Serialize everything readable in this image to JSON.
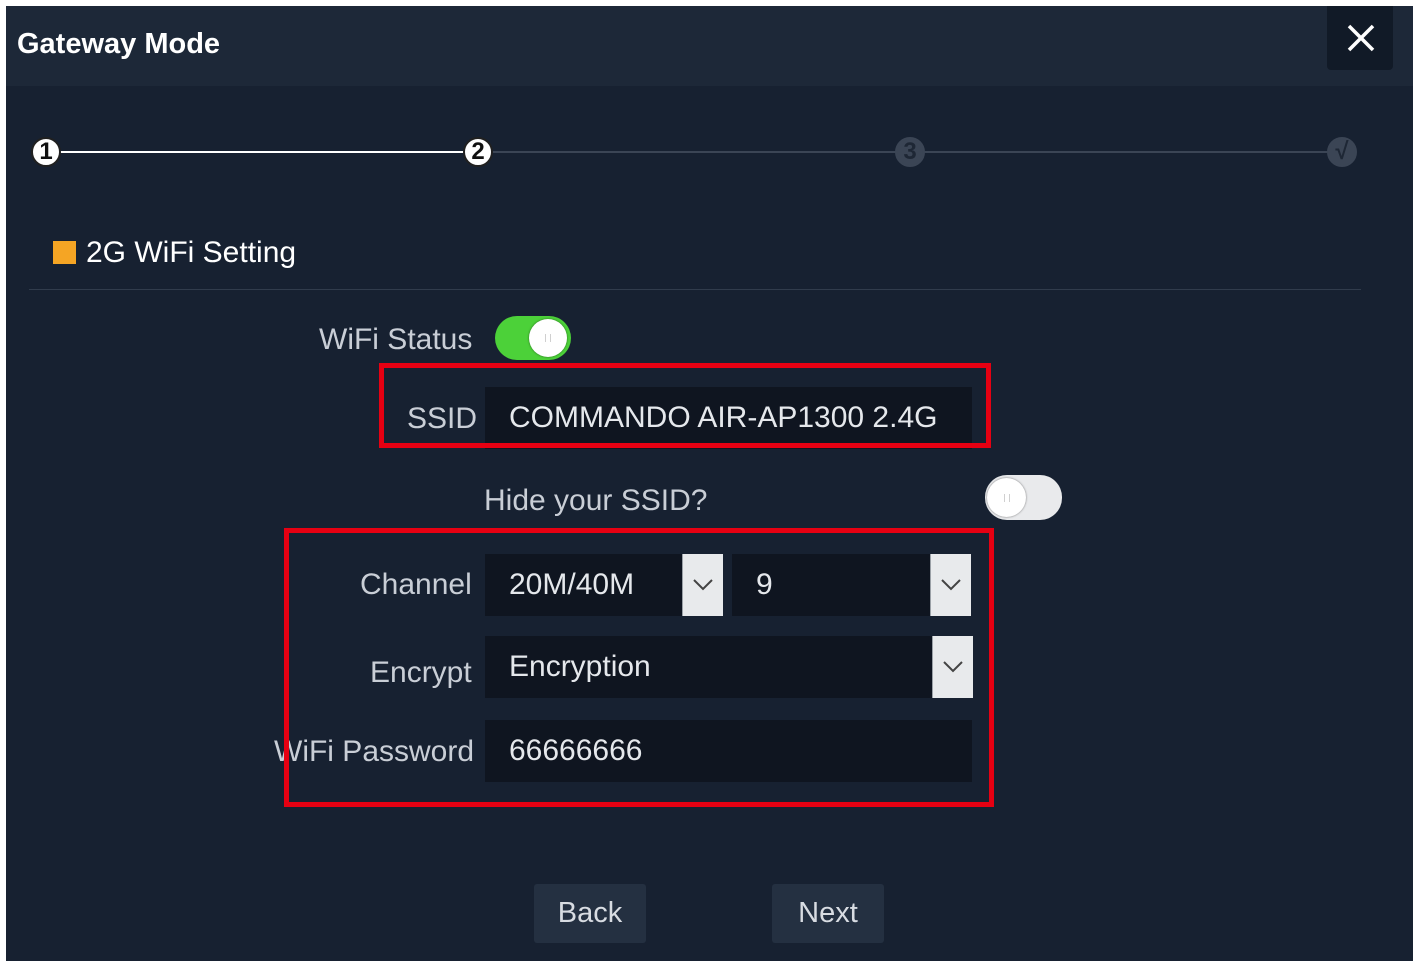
{
  "dialog": {
    "title": "Gateway Mode",
    "close_icon": "close-icon"
  },
  "stepper": {
    "steps": [
      {
        "label": "1",
        "state": "completed"
      },
      {
        "label": "2",
        "state": "active"
      },
      {
        "label": "3",
        "state": "inactive"
      },
      {
        "label": "√",
        "state": "inactive"
      }
    ]
  },
  "section": {
    "title": "2G WiFi Setting",
    "marker_color": "#f5a524"
  },
  "form": {
    "wifi_status": {
      "label": "WiFi Status",
      "enabled": true
    },
    "ssid": {
      "label": "SSID",
      "value": "COMMANDO AIR-AP1300 2.4G"
    },
    "hide_ssid": {
      "label": "Hide your SSID?",
      "enabled": false
    },
    "channel": {
      "label": "Channel",
      "bandwidth": "20M/40M",
      "number": "9"
    },
    "encrypt": {
      "label": "Encrypt",
      "value": "Encryption"
    },
    "password": {
      "label": "WiFi Password",
      "value": "66666666"
    }
  },
  "buttons": {
    "back": "Back",
    "next": "Next"
  },
  "colors": {
    "background": "#172131",
    "toggle_on": "#4cd139",
    "highlight": "#e60012"
  }
}
